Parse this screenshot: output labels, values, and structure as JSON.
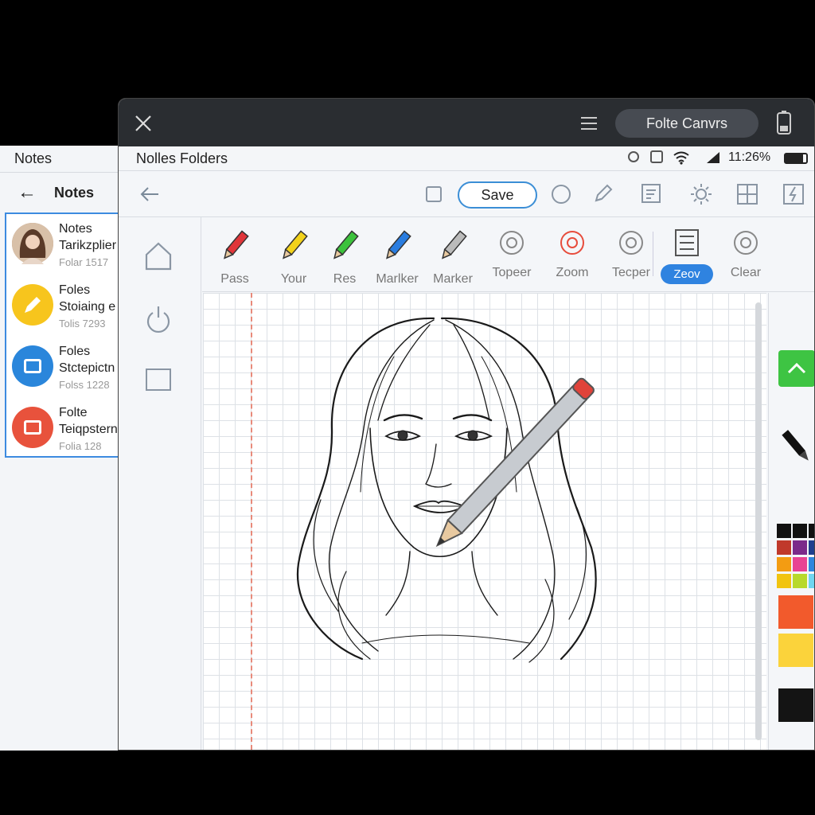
{
  "bg_window": {
    "title": "Notes",
    "nav_title": "Notes",
    "items": [
      {
        "title": "Notes",
        "subtitle": "Tarikzplier",
        "meta": "Folar 1517",
        "avatar": "profile-photo",
        "color": "#b98b6e"
      },
      {
        "title": "Foles",
        "subtitle": "Stoiaing e",
        "meta": "Tolis 7293",
        "avatar": "pencil-icon",
        "color": "#f7c51d"
      },
      {
        "title": "Foles",
        "subtitle": "Stctepictn",
        "meta": "Folss 1228",
        "avatar": "folder-icon",
        "color": "#2a86db"
      },
      {
        "title": "Folte",
        "subtitle": "Teiqpstern",
        "meta": "Folia 128",
        "avatar": "document-icon",
        "color": "#e8523c"
      }
    ]
  },
  "titlebar": {
    "app_title": "Folte Canvrs"
  },
  "status": {
    "folder_path": "Nolles Folders",
    "battery": "11:26%"
  },
  "toolbar": {
    "save_label": "Save"
  },
  "tools": [
    {
      "label": "Pass",
      "icon": "red-pencil-icon",
      "color": "#e0353a"
    },
    {
      "label": "Your",
      "icon": "yellow-pencil-icon",
      "color": "#f2d21b"
    },
    {
      "label": "Res",
      "icon": "green-pencil-icon",
      "color": "#3cc23c"
    },
    {
      "label": "Marlker",
      "icon": "blue-pencil-icon",
      "color": "#2a7de0"
    },
    {
      "label": "Marker",
      "icon": "eraser-icon",
      "color": "#bbbbbb"
    },
    {
      "label": "Topeer",
      "icon": "shape-icon",
      "color": "#888888"
    },
    {
      "label": "Zoom",
      "icon": "zoom-icon",
      "color": "#e74c3c"
    },
    {
      "label": "Tecper",
      "icon": "stamp-icon",
      "color": "#888888"
    },
    {
      "label": "Zeov",
      "icon": "layout-icon",
      "color": "#2f83e0"
    },
    {
      "label": "Clear",
      "icon": "info-icon",
      "color": "#888888"
    }
  ],
  "colors": {
    "accent": "#2f83e0",
    "green_button": "#3ec443",
    "swatches": [
      "#111111",
      "#111111",
      "#111111",
      "#c0392b",
      "#7b2a8a",
      "#1f3f8f",
      "#f39c12",
      "#e84393",
      "#2e86de",
      "#f1c40f",
      "#b8d92c",
      "#6fd6f0"
    ],
    "big_swatches": [
      "#f25a2c",
      "#fbd33b",
      "#141414"
    ]
  }
}
